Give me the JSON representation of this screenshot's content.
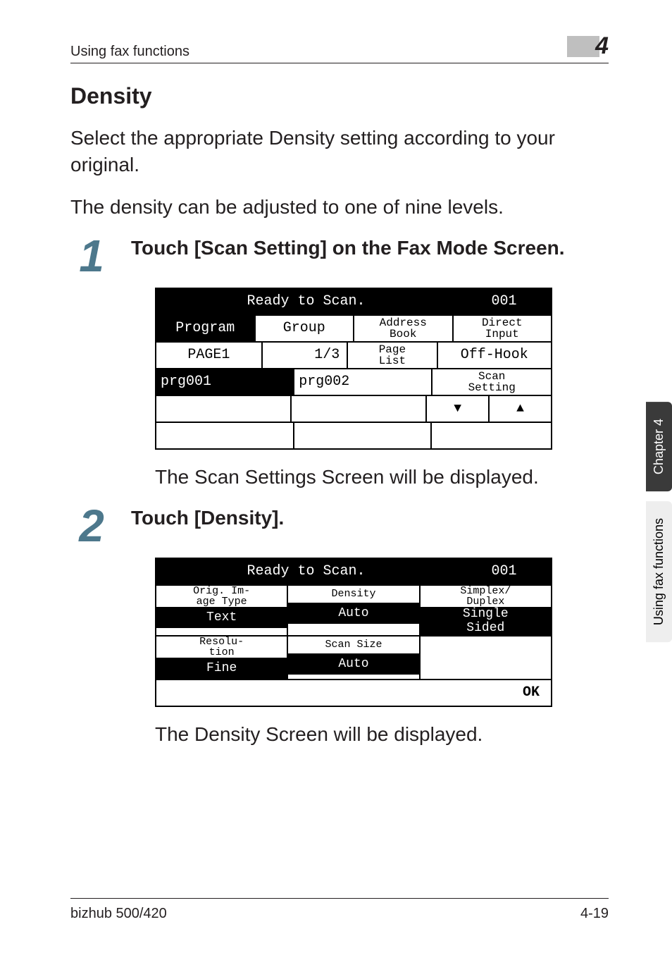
{
  "header": {
    "running": "Using fax functions",
    "chapter_number": "4"
  },
  "section": {
    "title": "Density"
  },
  "paragraphs": {
    "p1": "Select the appropriate Density setting according to your original.",
    "p2": "The density can be adjusted to one of nine levels."
  },
  "steps": {
    "s1": {
      "num": "1",
      "text": "Touch [Scan Setting] on the Fax Mode Screen."
    },
    "s1_after": "The Scan Settings Screen will be displayed.",
    "s2": {
      "num": "2",
      "text": "Touch [Density]."
    },
    "s2_after": "The Density Screen will be displayed."
  },
  "lcd1": {
    "status": "Ready to Scan.",
    "counter": "001",
    "tabs": {
      "program": "Program",
      "group": "Group",
      "address": "Address\nBook",
      "direct": "Direct\nInput"
    },
    "page_row": {
      "page_label": "PAGE1",
      "page_pos": "1/3",
      "page_list": "Page\nList",
      "offhook": "Off-Hook"
    },
    "prg_row": {
      "prg1": "prg001",
      "prg2": "prg002",
      "scan": "Scan\nSetting"
    },
    "arrows": {
      "down": "▼",
      "up": "▲"
    }
  },
  "lcd2": {
    "status": "Ready to Scan.",
    "counter": "001",
    "col1": {
      "top": "Orig. Im-\nage Type",
      "bot": "Text"
    },
    "col2": {
      "top": "Density",
      "bot": "Auto"
    },
    "col3": {
      "top": "Simplex/\nDuplex",
      "bot": "Single\nSided"
    },
    "col4": {
      "top": "Resolu-\ntion",
      "bot": "Fine"
    },
    "col5": {
      "top": "Scan Size",
      "bot": "Auto"
    },
    "ok": "OK"
  },
  "sidetabs": {
    "dark": "Chapter 4",
    "light": "Using fax functions"
  },
  "footer": {
    "left": "bizhub 500/420",
    "right": "4-19"
  }
}
